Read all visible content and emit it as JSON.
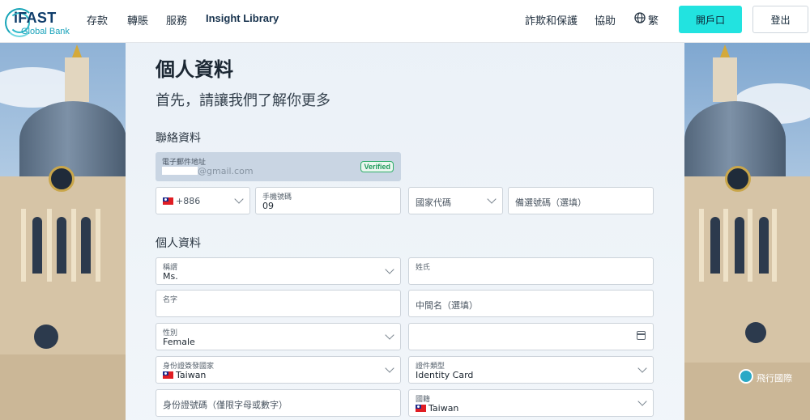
{
  "brand": {
    "name": "iFAST",
    "sub": "Global Bank"
  },
  "nav": {
    "deposits": "存款",
    "transfer": "轉賬",
    "services": "服務",
    "insight": "Insight Library",
    "fraud": "詐欺和保護",
    "help": "協助",
    "lang": "繁",
    "open_account": "開戶口",
    "logout": "登出"
  },
  "page": {
    "title": "個人資料",
    "subtitle": "首先，請讓我們了解你更多"
  },
  "contact": {
    "section_title": "聯絡資料",
    "email_label": "電子郵件地址",
    "email_value": "@gmail.com",
    "verified_badge": "Verified",
    "phone_code": "+886",
    "mobile_label": "手機號碼",
    "mobile_value": "09",
    "country_code_placeholder": "國家代碼",
    "backup_number_placeholder": "備選號碼（選填）"
  },
  "personal": {
    "section_title": "個人資料",
    "title_label": "稱謂",
    "title_value": "Ms.",
    "surname_label": "姓氏",
    "surname_value": "",
    "first_name_label": "名字",
    "first_name_value": "",
    "middle_name_placeholder": "中間名（選填）",
    "gender_label": "性別",
    "gender_value": "Female",
    "dob_value": "",
    "id_country_label": "身份證簽發國家",
    "id_country_value": "Taiwan",
    "id_type_label": "證件類型",
    "id_type_value": "Identity Card",
    "id_number_placeholder": "身份證號碼（僅限字母或數字）",
    "nationality_label": "國籍",
    "nationality_value": "Taiwan"
  },
  "watermark": "飛行國際"
}
